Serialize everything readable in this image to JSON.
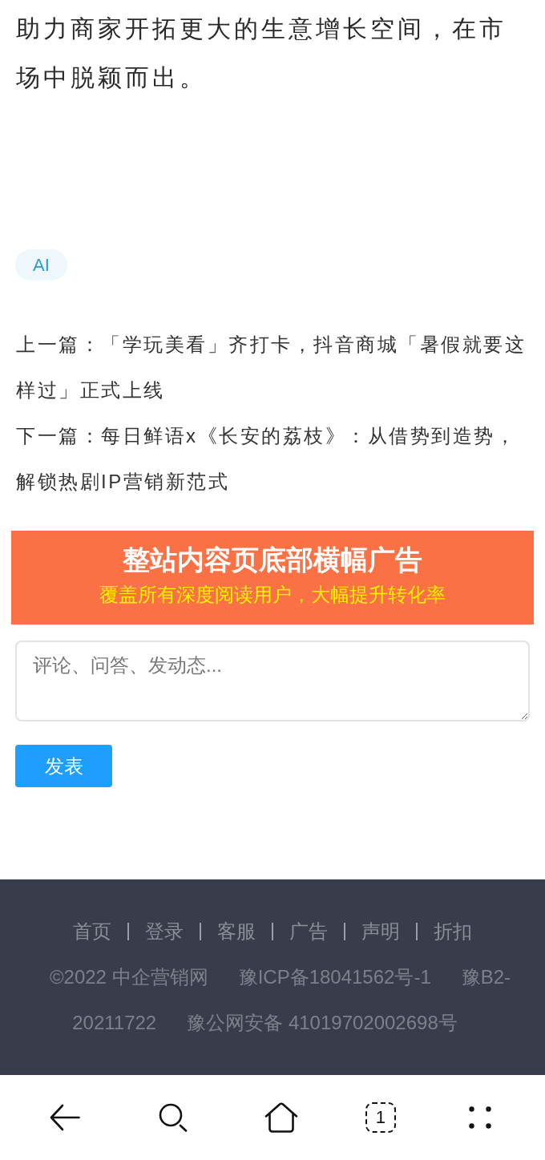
{
  "article": {
    "paragraph": "助力商家开拓更大的生意增长空间，在市场中脱颖而出。"
  },
  "tags": [
    {
      "label": "AI"
    }
  ],
  "article_nav": [
    "上一篇：「学玩美看」齐打卡，抖音商城「暑假就要这样过」正式上线",
    "下一篇：每日鲜语x《长安的荔枝》：从借势到造势，解锁热剧IP营销新范式"
  ],
  "ad_banner": {
    "title": "整站内容页底部横幅广告",
    "subtitle": "覆盖所有深度阅读用户，大幅提升转化率"
  },
  "comment_box": {
    "placeholder": "评论、问答、发动态...",
    "submit": "发表"
  },
  "footer": {
    "links": [
      "首页",
      "登录",
      "客服",
      "广告",
      "声明",
      "折扣"
    ],
    "info": [
      "©2022 中企营销网",
      "豫ICP备18041562号-1",
      "豫B2-20211722",
      "豫公网安备 41019702002698号"
    ]
  },
  "bottom_nav": {
    "tab_count": "1"
  }
}
